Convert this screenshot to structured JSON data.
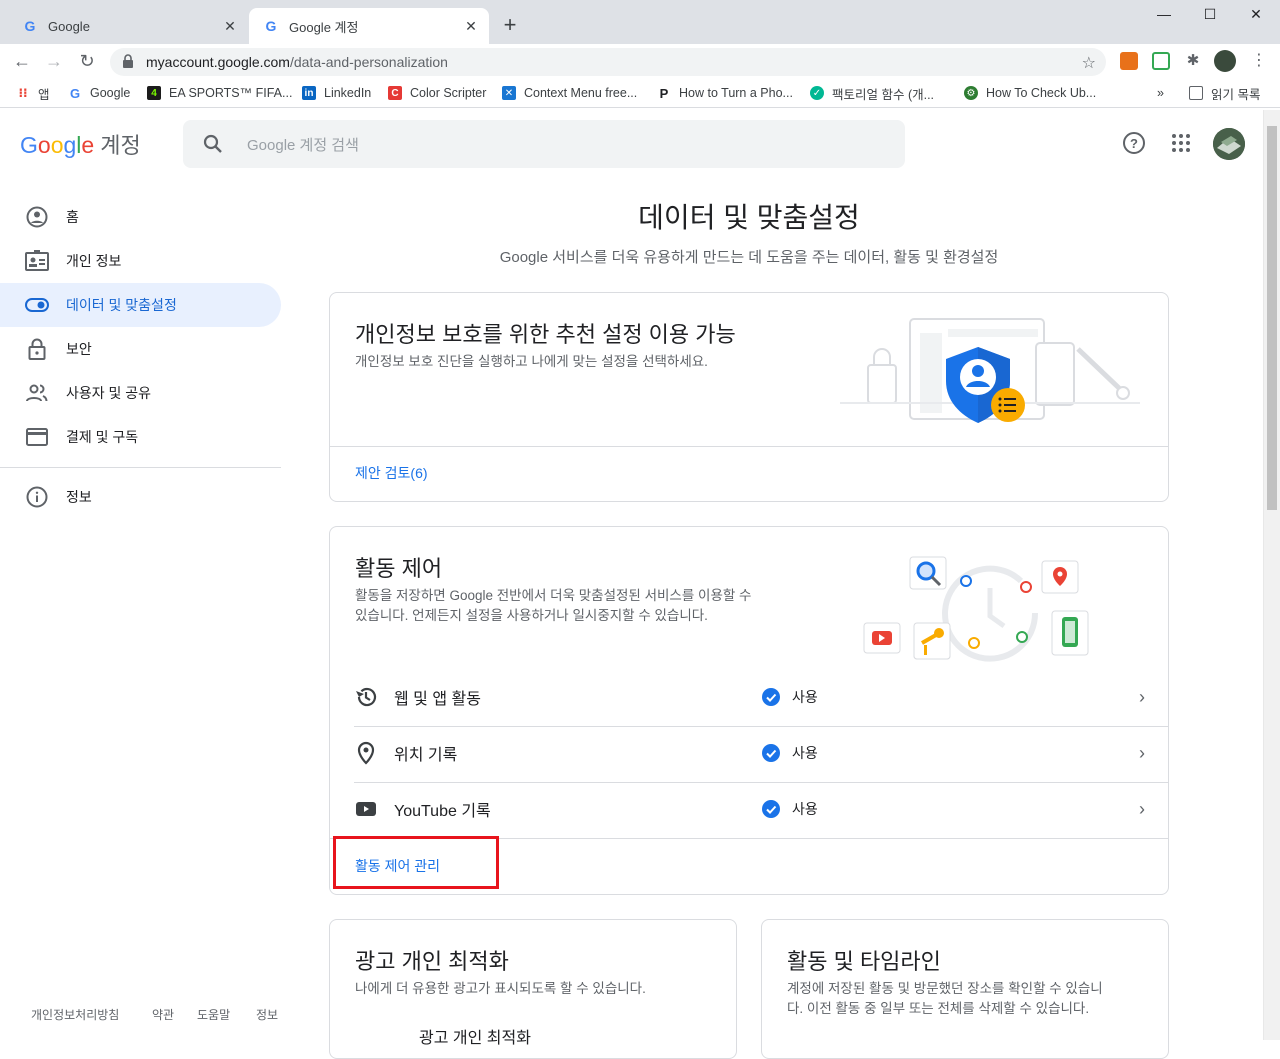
{
  "browser": {
    "tabs": [
      {
        "title": "Google",
        "active": false
      },
      {
        "title": "Google 계정",
        "active": true
      }
    ],
    "url_host": "myaccount.google.com",
    "url_path": "/data-and-personalization",
    "bookmarks": [
      {
        "label": "앱",
        "icon": "apps-grid-icon"
      },
      {
        "label": "Google",
        "icon": "google-icon"
      },
      {
        "label": "EA SPORTS™ FIFA...",
        "icon": "ea-icon"
      },
      {
        "label": "LinkedIn",
        "icon": "linkedin-icon"
      },
      {
        "label": "Color Scripter",
        "icon": "color-scripter-icon"
      },
      {
        "label": "Context Menu free...",
        "icon": "context-menu-icon"
      },
      {
        "label": "How to Turn a Pho...",
        "icon": "p-icon"
      },
      {
        "label": "팩토리얼 함수 (개...",
        "icon": "factorial-icon"
      },
      {
        "label": "How To Check Ub...",
        "icon": "gear-green-icon"
      }
    ],
    "reading_list": "읽기 목록",
    "more": "»"
  },
  "header": {
    "logo_google": "Google",
    "logo_account": "계정",
    "search_placeholder": "Google 계정 검색"
  },
  "sidebar": {
    "items": [
      {
        "label": "홈",
        "icon": "account-circle-icon"
      },
      {
        "label": "개인 정보",
        "icon": "id-card-icon"
      },
      {
        "label": "데이터 및 맞춤설정",
        "icon": "toggle-icon",
        "active": true
      },
      {
        "label": "보안",
        "icon": "lock-icon"
      },
      {
        "label": "사용자 및 공유",
        "icon": "people-icon"
      },
      {
        "label": "결제 및 구독",
        "icon": "credit-card-icon"
      },
      {
        "label": "정보",
        "icon": "info-icon"
      }
    ],
    "footer": [
      "개인정보처리방침",
      "약관",
      "도움말",
      "정보"
    ]
  },
  "main": {
    "title": "데이터 및 맞춤설정",
    "subtitle": "Google 서비스를 더욱 유용하게 만드는 데 도움을 주는 데이터, 활동 및 환경설정",
    "privacy_card": {
      "title": "개인정보 보호를 위한 추천 설정 이용 가능",
      "desc": "개인정보 보호 진단을 실행하고 나에게 맞는 설정을 선택하세요.",
      "link": "제안 검토(6)"
    },
    "activity_card": {
      "title": "활동 제어",
      "desc_line1": "활동을 저장하면 Google 전반에서 더욱 맞춤설정된 서비스를 이용할 수",
      "desc_line2": "있습니다. 언제든지 설정을 사용하거나 일시중지할 수 있습니다.",
      "rows": [
        {
          "label": "웹 및 앱 활동",
          "status": "사용",
          "icon": "history-icon"
        },
        {
          "label": "위치 기록",
          "status": "사용",
          "icon": "location-pin-icon"
        },
        {
          "label": "YouTube 기록",
          "status": "사용",
          "icon": "youtube-icon"
        }
      ],
      "manage_link": "활동 제어 관리"
    },
    "ads_card": {
      "title": "광고 개인 최적화",
      "desc": "나에게 더 유용한 광고가 표시되도록 할 수 있습니다.",
      "sub": "광고 개인 최적화"
    },
    "timeline_card": {
      "title": "활동 및 타임라인",
      "desc_line1": "계정에 저장된 활동 및 방문했던 장소를 확인할 수 있습니",
      "desc_line2": "다. 이전 활동 중 일부 또는 전체를 삭제할 수 있습니다."
    },
    "highlight_color": "#e8141c",
    "accent_color": "#1a73e8"
  }
}
